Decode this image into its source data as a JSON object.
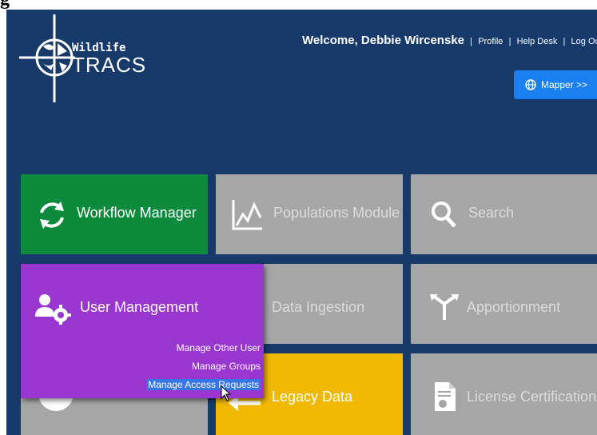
{
  "page_cut_glyph": "g",
  "brand": {
    "line1": "Wildlife",
    "line2": "TRACS"
  },
  "header": {
    "greeting": "Welcome, Debbie Wircenske",
    "links": [
      "Profile",
      "Help Desk",
      "Log Out"
    ],
    "mapper_label": "Mapper >>"
  },
  "tiles": {
    "workflow": "Workflow Manager",
    "populations": "Populations Module",
    "search": "Search",
    "user_mgmt": "User Management",
    "ingestion": "Data Ingestion",
    "apportionment": "Apportionment",
    "legacy": "Legacy Data",
    "license": "License Certification"
  },
  "submenu": [
    "Manage Other User",
    "Manage Groups",
    "Manage Access Requests"
  ],
  "colors": {
    "header_bg": "#173a6b",
    "green": "#0e8a3c",
    "purple": "#9a36d0",
    "yellow": "#f0b800",
    "gray": "#a6a6a6",
    "mapper": "#1a7ff0"
  },
  "icons": {
    "workflow": "refresh-icon",
    "populations": "line-chart-icon",
    "search": "search-icon",
    "user_mgmt": "users-gear-icon",
    "apportionment": "split-arrows-icon",
    "legacy": "arrow-left-icon",
    "license": "certificate-file-icon",
    "mapper": "globe-icon"
  }
}
